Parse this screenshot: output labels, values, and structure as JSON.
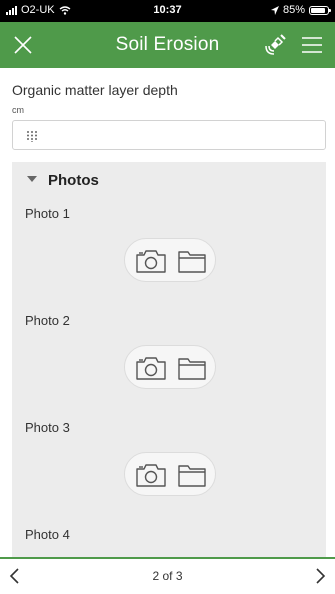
{
  "status_bar": {
    "carrier": "O2-UK",
    "time": "10:37",
    "battery": "85%",
    "battery_level": 0.85
  },
  "header": {
    "title": "Soil Erosion",
    "close_icon": "close-icon",
    "gps_icon": "gps-satellite-icon",
    "menu_icon": "menu-icon",
    "bg_color": "#4f9a4a"
  },
  "question": {
    "label": "Organic matter layer depth",
    "unit": "cm",
    "value": "",
    "keypad_icon": "numeric-keypad-icon"
  },
  "photos_group": {
    "title": "Photos",
    "items": [
      {
        "label": "Photo 1",
        "camera_icon": "camera-icon",
        "folder_icon": "folder-icon"
      },
      {
        "label": "Photo 2",
        "camera_icon": "camera-icon",
        "folder_icon": "folder-icon"
      },
      {
        "label": "Photo 3",
        "camera_icon": "camera-icon",
        "folder_icon": "folder-icon"
      },
      {
        "label": "Photo 4"
      }
    ]
  },
  "footer": {
    "page_indicator": "2 of 3",
    "current_page": 2,
    "total_pages": 3,
    "prev_icon": "chevron-left-icon",
    "next_icon": "chevron-right-icon"
  }
}
